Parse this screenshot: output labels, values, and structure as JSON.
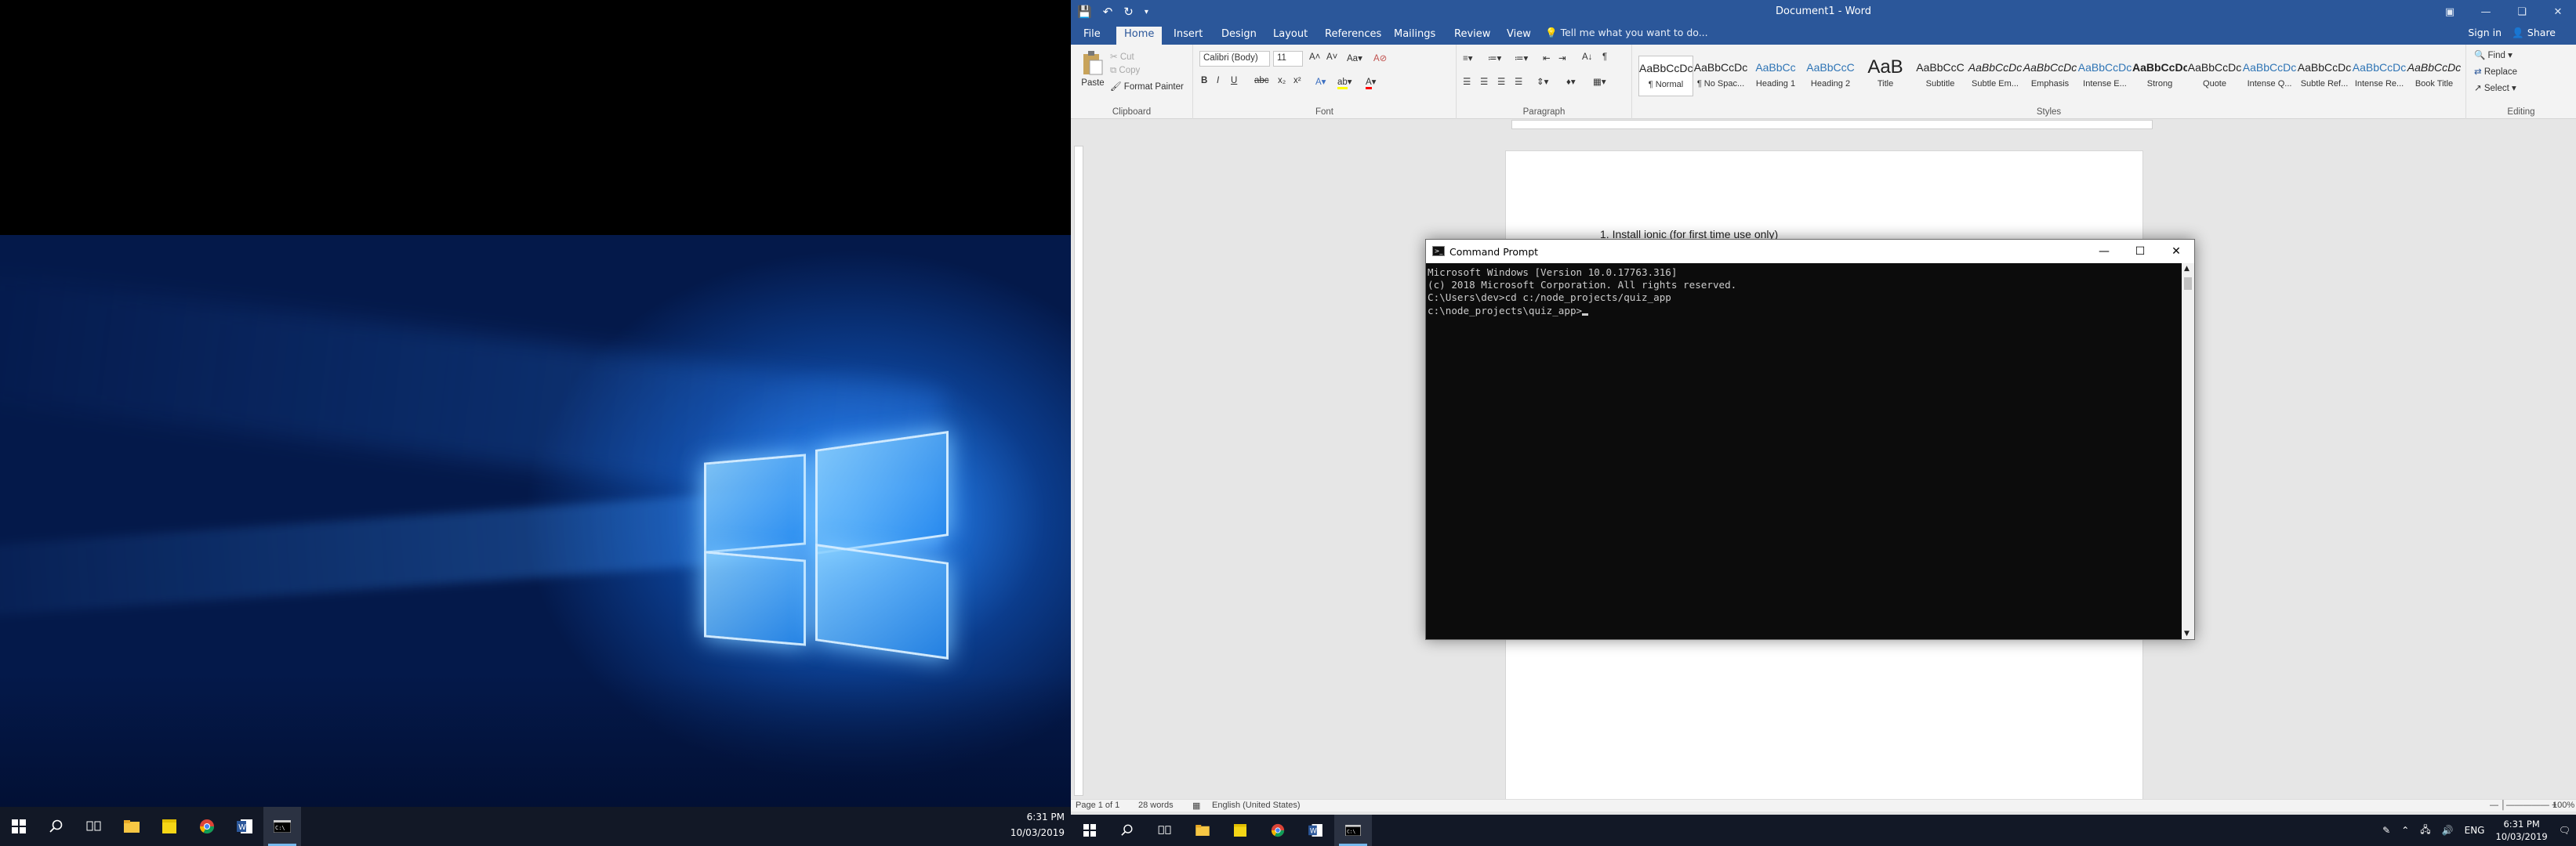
{
  "left_taskbar": {
    "items": [
      {
        "icon": "windows-start-icon"
      },
      {
        "icon": "search-icon"
      },
      {
        "icon": "task-view-icon"
      },
      {
        "icon": "file-explorer-icon"
      },
      {
        "icon": "sticky-notes-icon"
      },
      {
        "icon": "chrome-icon"
      },
      {
        "icon": "word-icon"
      },
      {
        "icon": "command-prompt-icon"
      }
    ],
    "time": "6:31 PM",
    "date": "10/03/2019"
  },
  "word": {
    "title": "Document1 - Word",
    "tabs": [
      "File",
      "Home",
      "Insert",
      "Design",
      "Layout",
      "References",
      "Mailings",
      "Review",
      "View"
    ],
    "active_tab": "Home",
    "tell_me": "Tell me what you want to do...",
    "sign_in": "Sign in",
    "share": "Share",
    "clipboard": {
      "paste": "Paste",
      "cut": "Cut",
      "copy": "Copy",
      "format_painter": "Format Painter",
      "label": "Clipboard"
    },
    "font": {
      "family": "Calibri (Body)",
      "size": "11",
      "label": "Font"
    },
    "paragraph_label": "Paragraph",
    "styles": [
      {
        "sample": "AaBbCcDc",
        "name": "¶ Normal"
      },
      {
        "sample": "AaBbCcDc",
        "name": "¶ No Spac..."
      },
      {
        "sample": "AaBbCc",
        "name": "Heading 1"
      },
      {
        "sample": "AaBbCcC",
        "name": "Heading 2"
      },
      {
        "sample": "AaB",
        "name": "Title"
      },
      {
        "sample": "AaBbCcC",
        "name": "Subtitle"
      },
      {
        "sample": "AaBbCcDc",
        "name": "Subtle Em..."
      },
      {
        "sample": "AaBbCcDc",
        "name": "Emphasis"
      },
      {
        "sample": "AaBbCcDc",
        "name": "Intense E..."
      },
      {
        "sample": "AaBbCcDc",
        "name": "Strong"
      },
      {
        "sample": "AaBbCcDc",
        "name": "Quote"
      },
      {
        "sample": "AaBbCcDc",
        "name": "Intense Q..."
      },
      {
        "sample": "AaBbCcDc",
        "name": "Subtle Ref..."
      },
      {
        "sample": "AaBbCcDc",
        "name": "Intense Re..."
      },
      {
        "sample": "AaBbCcDc",
        "name": "Book Title"
      }
    ],
    "styles_label": "Styles",
    "editing": {
      "find": "Find",
      "replace": "Replace",
      "select": "Select",
      "label": "Editing"
    },
    "document_line": "1.    Install ionic (for first time use only)",
    "status": {
      "page": "Page 1 of 1",
      "words": "28 words",
      "language": "English (United States)",
      "zoom": "100%"
    }
  },
  "cmd": {
    "title": "Command Prompt",
    "lines": [
      "Microsoft Windows [Version 10.0.17763.316]",
      "(c) 2018 Microsoft Corporation. All rights reserved.",
      "",
      "C:\\Users\\dev>cd c:/node_projects/quiz_app",
      "",
      "c:\\node_projects\\quiz_app>"
    ]
  },
  "right_taskbar": {
    "items": [
      {
        "icon": "windows-start-icon"
      },
      {
        "icon": "search-icon"
      },
      {
        "icon": "task-view-icon"
      },
      {
        "icon": "file-explorer-icon"
      },
      {
        "icon": "sticky-notes-icon"
      },
      {
        "icon": "chrome-icon"
      },
      {
        "icon": "word-icon"
      },
      {
        "icon": "command-prompt-icon"
      }
    ],
    "language": "ENG",
    "time": "6:31 PM",
    "date": "10/03/2019"
  },
  "colors": {
    "word_blue": "#2b579a",
    "taskbar": "#121826",
    "console_bg": "#0c0c0c",
    "console_text": "#cccccc"
  }
}
